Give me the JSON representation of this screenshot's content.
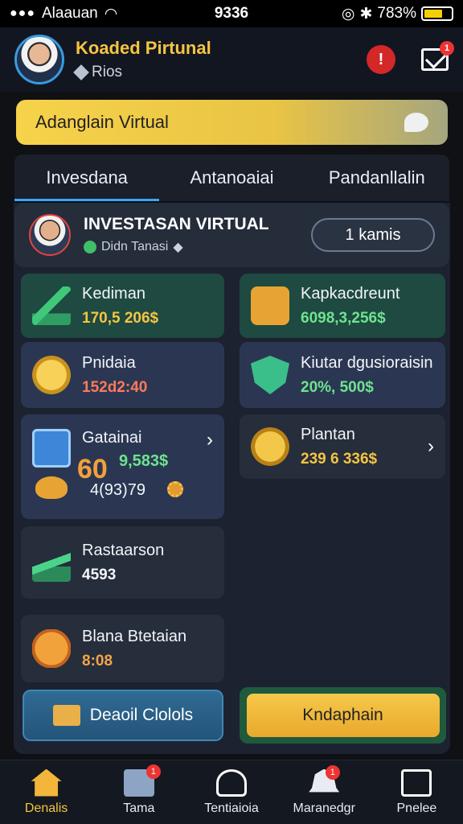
{
  "status_bar": {
    "carrier": "Alaauan",
    "time": "9336",
    "battery_pct": "783%"
  },
  "header": {
    "title": "Koaded Pirtunal",
    "subtitle": "Rios",
    "alert_label": "!",
    "mail_badge": "1"
  },
  "banner": {
    "label": "Adanglain Virtual"
  },
  "tabs": [
    {
      "label": "Invesdana",
      "active": true
    },
    {
      "label": "Antanoaiai",
      "active": false
    },
    {
      "label": "Pandanllalin",
      "active": false
    }
  ],
  "profile": {
    "title": "INVESTASAN VIRTUAL",
    "subtitle": "Didn Tanasi",
    "tag_label": "1 kamis"
  },
  "cards": {
    "kediman": {
      "label": "Kediman",
      "value": "170,5 206$"
    },
    "kapkan": {
      "label": "Kapkacdreunt",
      "value": "6098,3,256$"
    },
    "pnidaia": {
      "label": "Pnidaia",
      "value": "152d2:40"
    },
    "kiutar": {
      "label": "Kiutar dgusioraisin",
      "value": "20%, 500$"
    },
    "gatainai": {
      "label": "Gatainai",
      "big_value": "60",
      "sub_value": "9,583$",
      "extra_value": "4(93)79"
    },
    "plantan": {
      "label": "Plantan",
      "value": "239 6 336$"
    },
    "rastaarson": {
      "label": "Rastaarson",
      "value": "4593"
    },
    "blana": {
      "label": "Blana Btetaian",
      "value": "8:08"
    }
  },
  "actions": {
    "primary_label": "Deaoil Clolols",
    "secondary_label": "Kndaphain"
  },
  "bottom_nav": [
    {
      "label": "Denalis",
      "icon": "home-icon",
      "active": true
    },
    {
      "label": "Tama",
      "icon": "wallet-icon",
      "badge": "1"
    },
    {
      "label": "Tentiaioia",
      "icon": "user-icon"
    },
    {
      "label": "Maranedgr",
      "icon": "bell-icon",
      "badge": "1"
    },
    {
      "label": "Pnelee",
      "icon": "frame-icon"
    }
  ],
  "colors": {
    "accent": "#f5c542",
    "tab_underline": "#3aa6ff",
    "positive": "#6ee38f"
  }
}
